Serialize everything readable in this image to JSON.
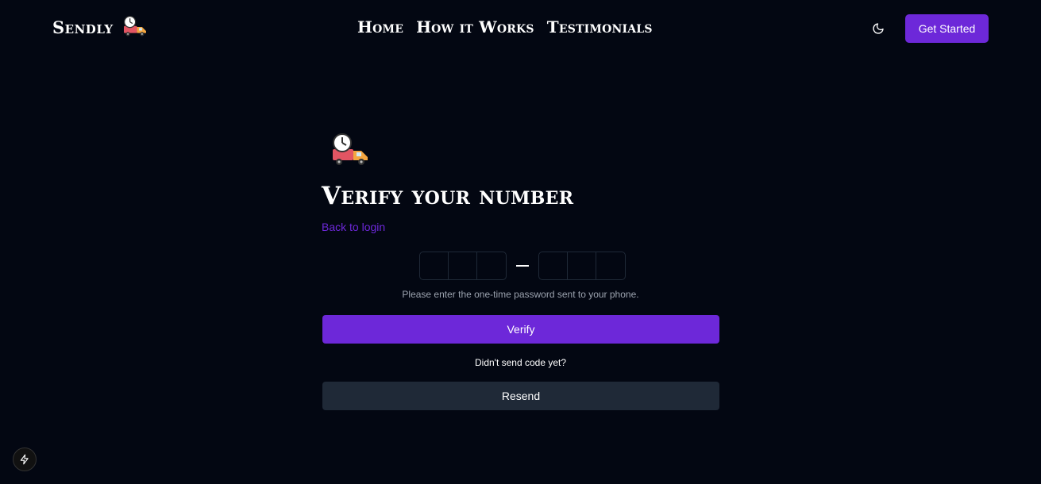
{
  "brand": {
    "name": "Sendly",
    "logo_icon": "delivery-truck-clock-icon"
  },
  "nav": {
    "items": [
      {
        "label": "Home"
      },
      {
        "label": "How it Works"
      },
      {
        "label": "Testimonials"
      }
    ]
  },
  "header": {
    "theme_toggle_icon": "moon-icon",
    "get_started_label": "Get Started"
  },
  "verify": {
    "icon": "delivery-truck-clock-icon",
    "title": "Verify your number",
    "back_link": "Back to login",
    "otp": {
      "group_1": [
        "",
        "",
        ""
      ],
      "group_2": [
        "",
        "",
        ""
      ],
      "separator": "—"
    },
    "help_text": "Please enter the one-time password sent to your phone.",
    "verify_label": "Verify",
    "resend_prompt": "Didn't send code yet?",
    "resend_label": "Resend"
  },
  "dev_badge": {
    "icon": "lightning-icon"
  },
  "colors": {
    "background": "#030712",
    "accent": "#6d28d9",
    "secondary_button": "#1f2937",
    "muted_text": "#9ca3af"
  }
}
